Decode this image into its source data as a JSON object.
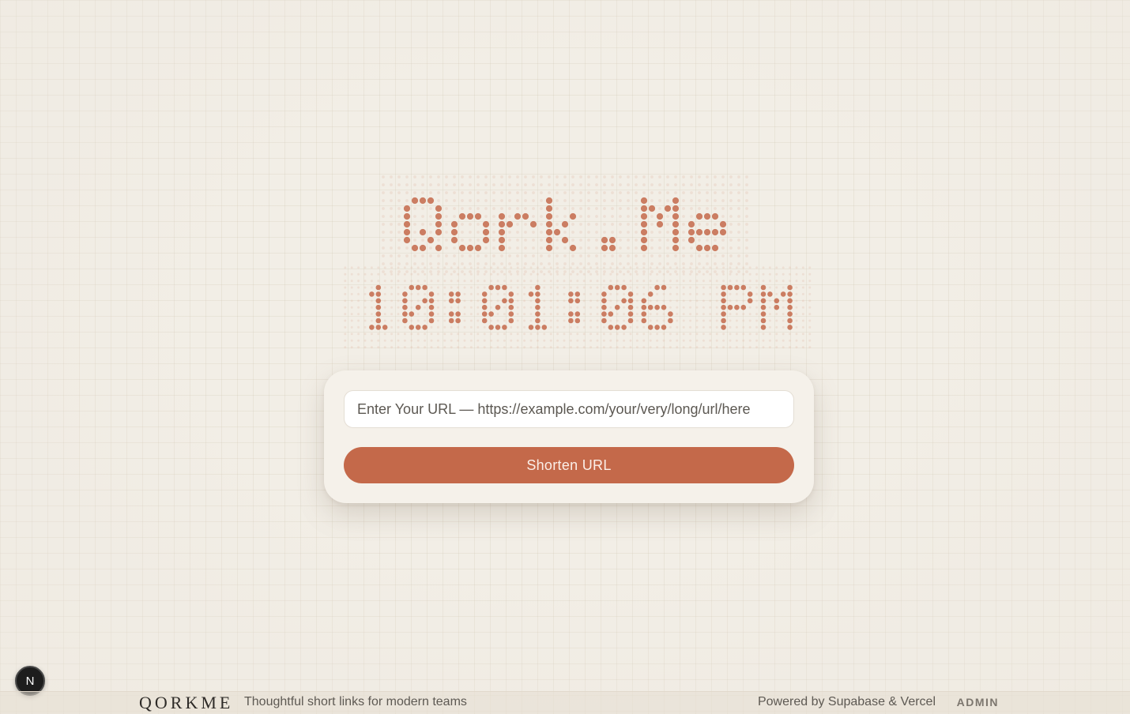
{
  "header": {
    "title": "Qork.Me",
    "clock": "10:01:06 PM"
  },
  "form": {
    "url_placeholder": "Enter Your URL — https://example.com/your/very/long/url/here",
    "url_value": "",
    "submit_label": "Shorten URL"
  },
  "footer": {
    "brand": "QORKME",
    "tagline": "Thoughtful short links for modern teams",
    "powered_by": "Powered by Supabase & Vercel",
    "admin_label": "ADMIN"
  },
  "dev_indicator": {
    "label": "N"
  },
  "colors": {
    "accent": "#c4694a",
    "dot_dim": "#e6c3b3",
    "background": "#f2eee6"
  }
}
